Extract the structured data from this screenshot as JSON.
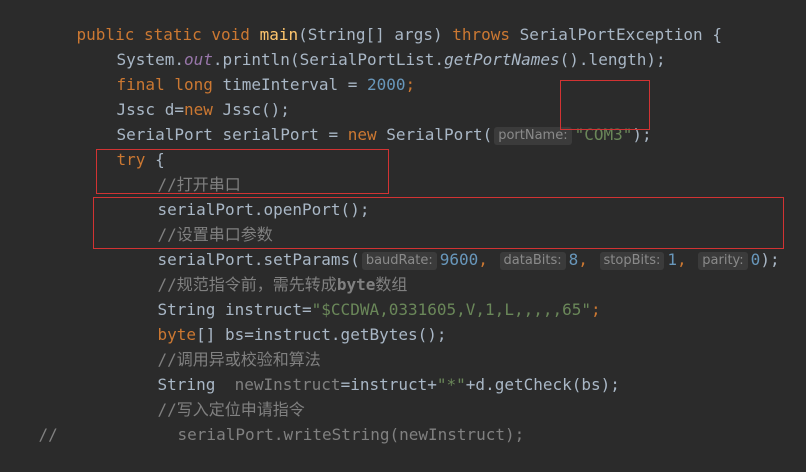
{
  "lines": {
    "l1": {
      "kw1": "public static void ",
      "fn": "main",
      "p1": "(String[] args) ",
      "kw2": "throws ",
      "p2": "SerialPortException {"
    },
    "l2": {
      "p1": "System.",
      "field": "out",
      "p2": ".println(SerialPortList.",
      "italic": "getPortNames",
      "p3": "().length);"
    },
    "l3": {
      "kw": "final long ",
      "p1": "timeInterval = ",
      "num": "2000",
      "p2": ";"
    },
    "l4": {
      "p1": "Jssc d=",
      "kw": "new ",
      "p2": "Jssc();"
    },
    "l5": {
      "p1": "SerialPort serialPort = ",
      "kw": "new ",
      "p2": "SerialPort(",
      "hint": "portName:",
      "str": "\"COM3\"",
      "p3": ");"
    },
    "l6": {
      "kw": "try ",
      "p1": "{"
    },
    "l7": {
      "cmt": "//打开串口"
    },
    "l8": {
      "p1": "serialPort.openPort();"
    },
    "l9": {
      "cmt": "//设置串口参数"
    },
    "l10": {
      "p1": "serialPort.setParams(",
      "h1": "baudRate:",
      "n1": "9600",
      "c1": ", ",
      "h2": "dataBits:",
      "n2": "8",
      "c2": ", ",
      "h3": "stopBits:",
      "n3": "1",
      "c3": ", ",
      "h4": "parity:",
      "n4": "0",
      "p2": ");"
    },
    "l11": {
      "cmt": "//规范指令前，需先转成",
      "cmtb": "byte",
      "cmt2": "数组"
    },
    "l12": {
      "p1": "String instruct=",
      "str": "\"$CCDWA,0331605,V,1,L,,,,,65\"",
      "p2": ";"
    },
    "l13": {
      "kw": "byte",
      "p1": "[] bs=instruct.getBytes();"
    },
    "l14": {
      "cmt": "//调用异或校验和算法"
    },
    "l15": {
      "p1": "String  ",
      "var": "newInstruct",
      "p2": "=instruct+",
      "str": "\"*\"",
      "p3": "+d.getCheck(bs);"
    },
    "l16": {
      "cmt": "//写入定位申请指令"
    },
    "l17": {
      "gut": "//",
      "p1": "serialPort.writeString(newInstruct);"
    }
  }
}
